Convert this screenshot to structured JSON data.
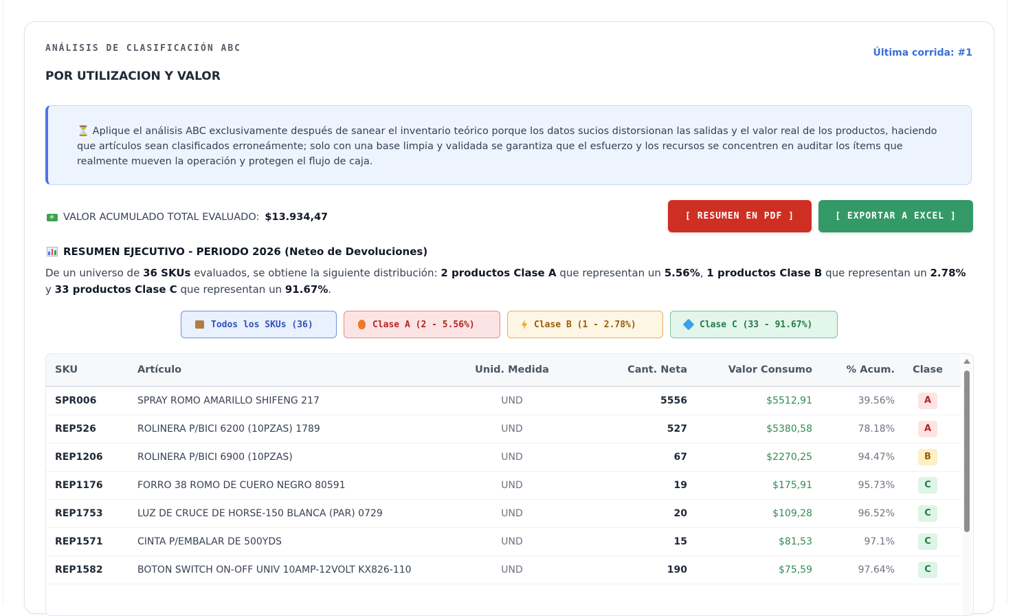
{
  "header": {
    "small_title": "ANÁLISIS DE CLASIFICACIÓN ABC",
    "main_title": "POR UTILIZACION Y VALOR",
    "last_run": "Última corrida: #1"
  },
  "notice": {
    "icon": "hourglass-icon",
    "text": "⏳ Aplique el análisis ABC exclusivamente después de sanear el inventario teórico porque los datos sucios distorsionan las salidas y el valor real de los productos, haciendo que artículos sean clasificados erroneámente; solo con una base limpia y validada se garantiza que el esfuerzo y los recursos se concentren en auditar los ítems que realmente mueven la operación y protegen el flujo de caja."
  },
  "total": {
    "label": "VALOR ACUMULADO TOTAL EVALUADO:",
    "value": "$13.934,47"
  },
  "buttons": {
    "pdf": "[ RESUMEN EN PDF ]",
    "excel": "[ EXPORTAR A EXCEL ]"
  },
  "summary": {
    "title": "RESUMEN EJECUTIVO - PERIODO 2026 (Neteo de Devoluciones)",
    "t1": "De un universo de ",
    "b1": "36 SKUs",
    "t2": " evaluados, se obtiene la siguiente distribución: ",
    "b2": "2 productos Clase A",
    "t3": " que representan un ",
    "b3": "5.56%",
    "t4": ", ",
    "b4": "1 productos Clase B",
    "t5": " que representan un ",
    "b5": "2.78%",
    "t6": " y ",
    "b6": "33 productos Clase C",
    "t7": " que representan un ",
    "b7": "91.67%",
    "t8": "."
  },
  "filters": {
    "all": "Todos los SKUs (36)",
    "a": "Clase A (2 - 5.56%)",
    "b": "Clase B (1 - 2.78%)",
    "c": "Clase C (33 - 91.67%)"
  },
  "table": {
    "headers": [
      "SKU",
      "Artículo",
      "Unid. Medida",
      "Cant. Neta",
      "Valor Consumo",
      "% Acum.",
      "Clase"
    ],
    "rows": [
      [
        "SPR006",
        "SPRAY ROMO AMARILLO SHIFENG 217",
        "UND",
        "5556",
        "$5512,91",
        "39.56%",
        "A"
      ],
      [
        "REP526",
        "ROLINERA P/BICI 6200 (10PZAS) 1789",
        "UND",
        "527",
        "$5380,58",
        "78.18%",
        "A"
      ],
      [
        "REP1206",
        "ROLINERA P/BICI 6900 (10PZAS)",
        "UND",
        "67",
        "$2270,25",
        "94.47%",
        "B"
      ],
      [
        "REP1176",
        "FORRO 38 ROMO DE CUERO NEGRO 80591",
        "UND",
        "19",
        "$175,91",
        "95.73%",
        "C"
      ],
      [
        "REP1753",
        "LUZ DE CRUCE DE HORSE-150 BLANCA (PAR) 0729",
        "UND",
        "20",
        "$109,28",
        "96.52%",
        "C"
      ],
      [
        "REP1571",
        "CINTA P/EMBALAR DE 500YDS",
        "UND",
        "15",
        "$81,53",
        "97.1%",
        "C"
      ],
      [
        "REP1582",
        "BOTON SWITCH ON-OFF UNIV 10AMP-12VOLT KX826-110",
        "UND",
        "190",
        "$75,59",
        "97.64%",
        "C"
      ]
    ]
  },
  "colors": {
    "accent_blue": "#4a74e8",
    "pdf_button": "#cf2e23",
    "excel_button": "#339966",
    "value_green": "#2f8a55"
  }
}
